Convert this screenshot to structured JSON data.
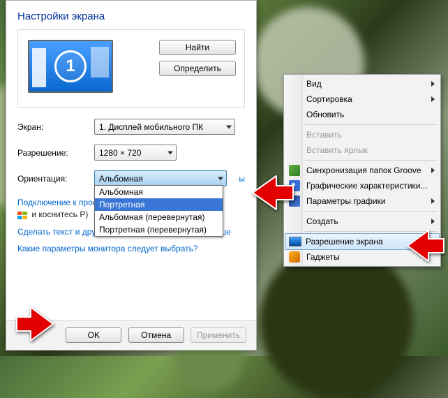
{
  "dialog": {
    "title": "Настройки экрана",
    "monitor_number": "1",
    "detect_btn": "Найти",
    "identify_btn": "Определить",
    "screen_label": "Экран:",
    "screen_value": "1. Дисплей мобильного ПК",
    "resolution_label": "Разрешение:",
    "resolution_value": "1280 × 720",
    "orientation_label": "Ориентация:",
    "orientation_value": "Альбомная",
    "orientation_options": {
      "o0": "Альбомная",
      "o1": "Портретная",
      "o2": "Альбомная (перевернутая)",
      "o3": "Портретная (перевернутая)"
    },
    "projector_link": "Подключение к проек",
    "projector_hint": "и коснитесь P)",
    "text_size_link": "Сделать текст и другие элементы больше или меньше",
    "which_settings_link": "Какие параметры монитора следует выбрать?",
    "truncated_tail": "ы",
    "ok_btn": "OK",
    "cancel_btn": "Отмена",
    "apply_btn": "Применить"
  },
  "context_menu": {
    "view": "Вид",
    "sort": "Сортировка",
    "refresh": "Обновить",
    "paste": "Вставить",
    "paste_shortcut": "Вставить ярлык",
    "groove_sync": "Синхронизация папок Groove",
    "gfx_props": "Графические характеристики...",
    "gfx_params": "Параметры графики",
    "create": "Создать",
    "screen_res": "Разрешение экрана",
    "gadgets": "Гаджеты"
  }
}
